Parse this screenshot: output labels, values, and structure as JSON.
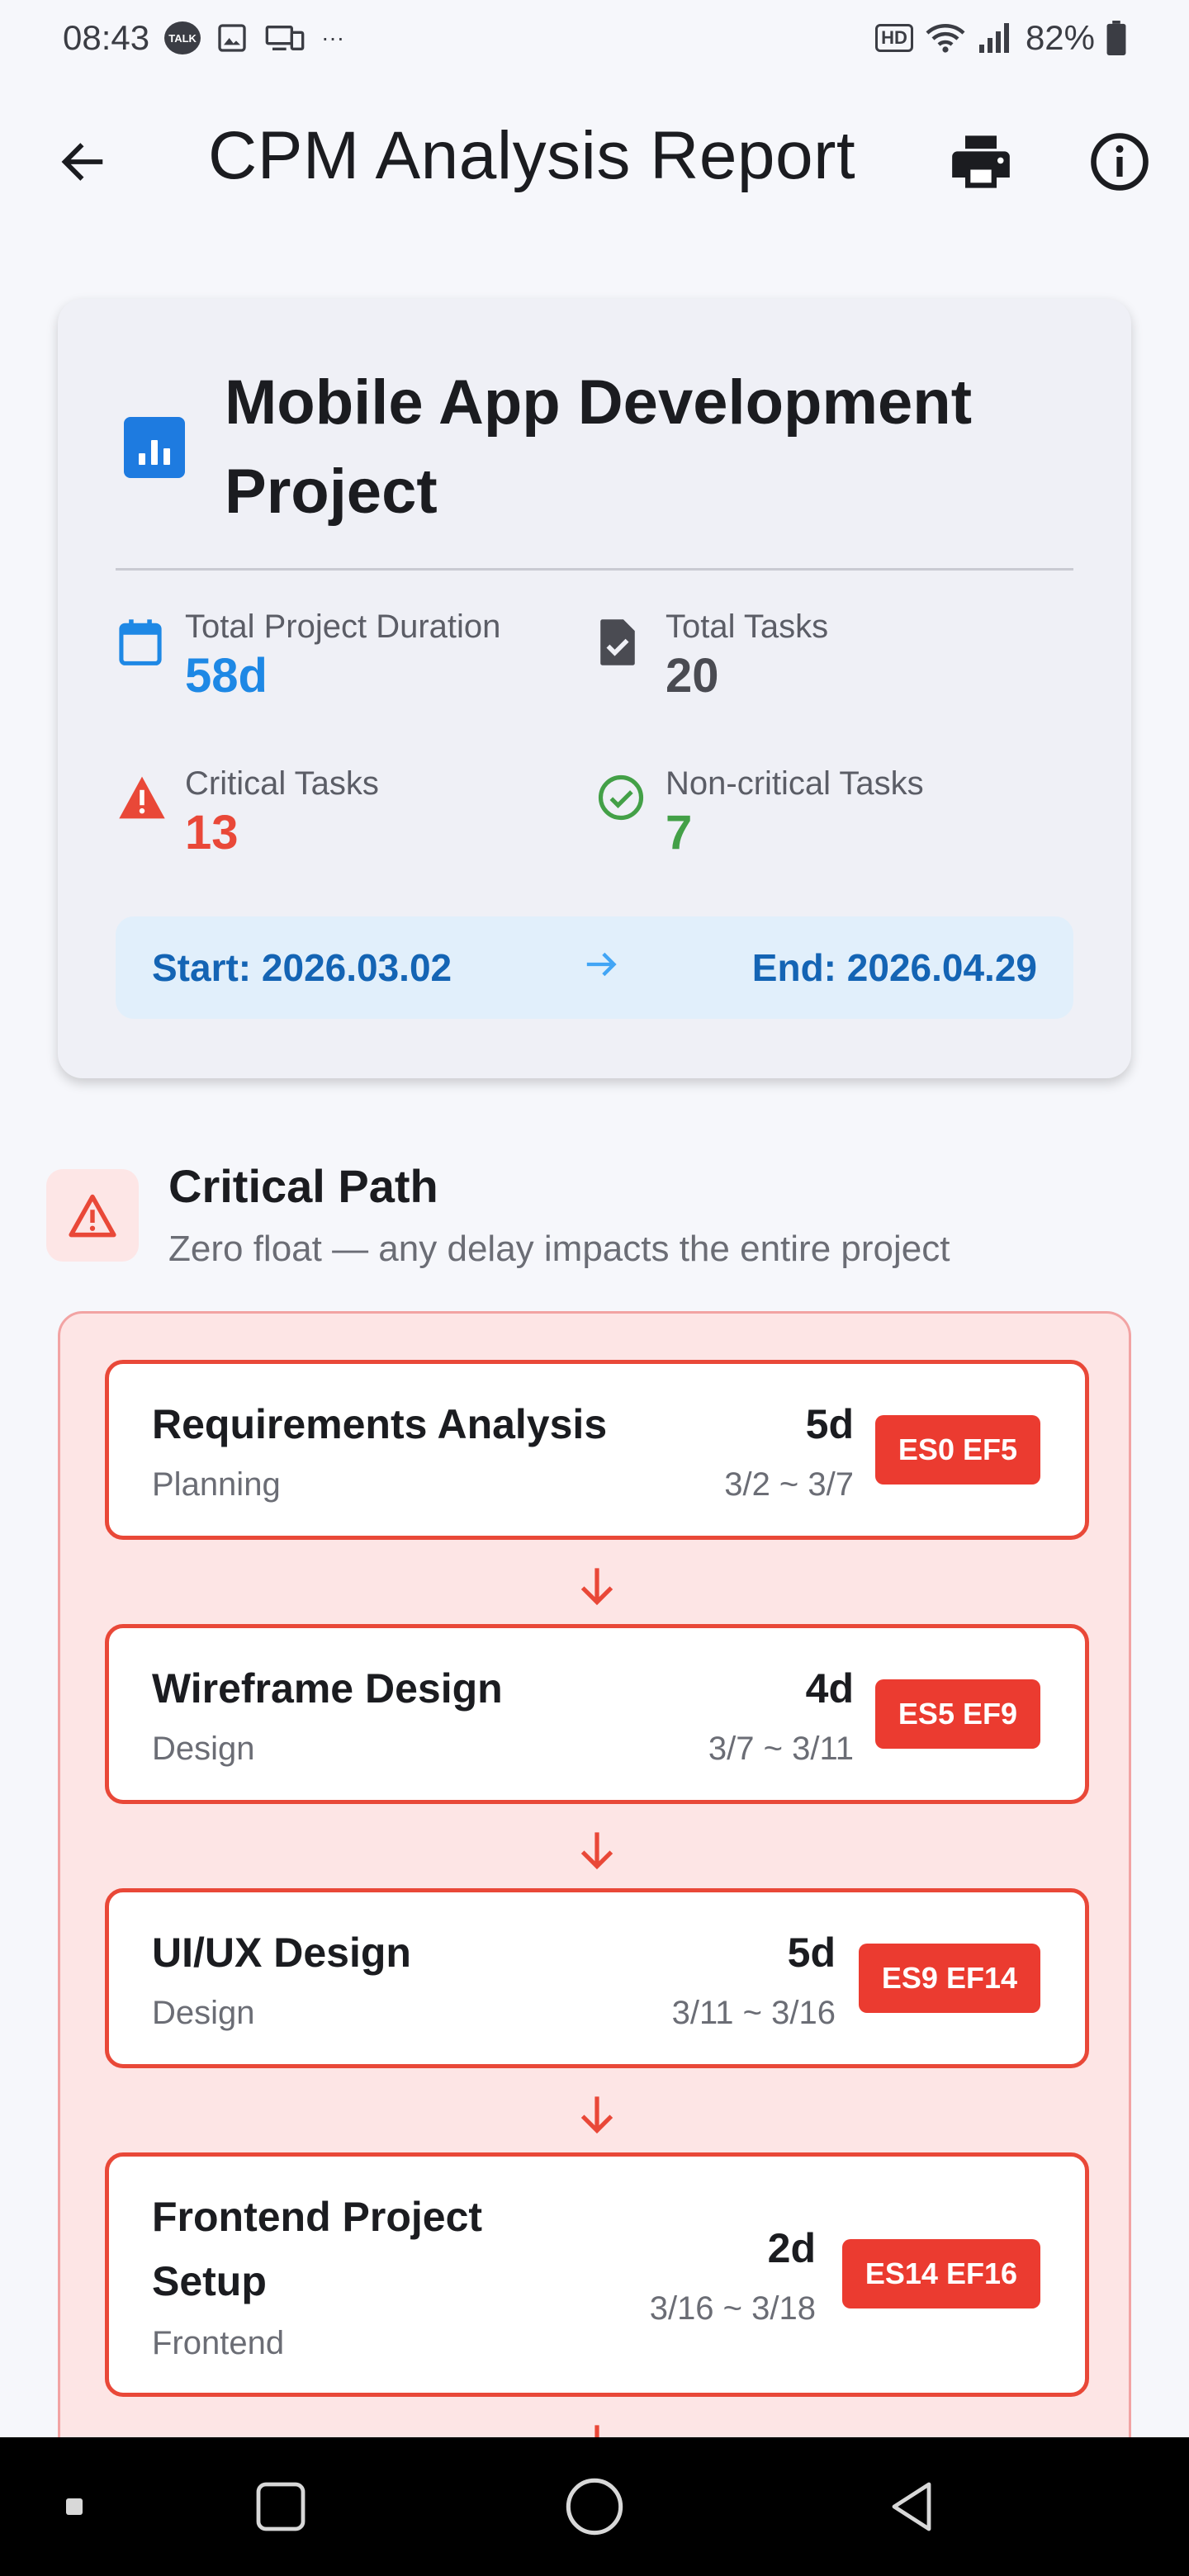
{
  "status": {
    "time": "08:43",
    "talk": "TALK",
    "hd": "HD",
    "battery": "82%",
    "more": "···"
  },
  "app_bar": {
    "title": "CPM Analysis Report"
  },
  "summary": {
    "project_title": "Mobile App Development Project",
    "stats": {
      "duration_label": "Total Project Duration",
      "duration_value": "58d",
      "tasks_label": "Total Tasks",
      "tasks_value": "20",
      "critical_label": "Critical Tasks",
      "critical_value": "13",
      "noncritical_label": "Non-critical Tasks",
      "noncritical_value": "7"
    },
    "start": "Start: 2026.03.02",
    "end": "End: 2026.04.29"
  },
  "critical": {
    "title": "Critical Path",
    "subtitle": "Zero float — any delay impacts the entire project",
    "tasks": [
      {
        "name": "Requirements Analysis",
        "category": "Planning",
        "duration": "5d",
        "dates": "3/2 ~ 3/7",
        "badge": "ES0 EF5"
      },
      {
        "name": "Wireframe Design",
        "category": "Design",
        "duration": "4d",
        "dates": "3/7 ~ 3/11",
        "badge": "ES5 EF9"
      },
      {
        "name": "UI/UX Design",
        "category": "Design",
        "duration": "5d",
        "dates": "3/11 ~ 3/16",
        "badge": "ES9 EF14"
      },
      {
        "name_line1": "Frontend Project",
        "name_line2": "Setup",
        "category": "Frontend",
        "duration": "2d",
        "dates": "3/16 ~ 3/18",
        "badge": "ES14 EF16"
      }
    ]
  },
  "colors": {
    "accent_blue": "#1e88e5",
    "critical_red": "#e94838",
    "noncritical_green": "#43a047",
    "neutral_value": "#4a4b52"
  }
}
